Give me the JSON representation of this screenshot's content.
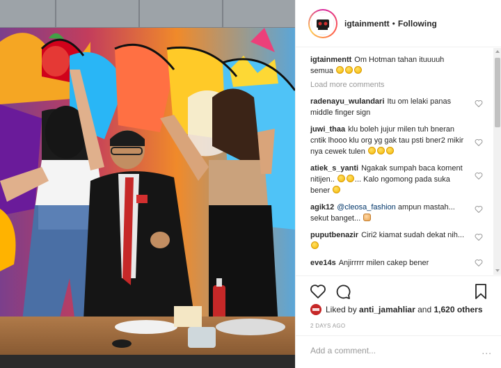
{
  "post": {
    "username": "igtainmentt",
    "separator": "•",
    "follow_state": "Following"
  },
  "caption": {
    "user": "igtainmentt",
    "text": "Om Hotman tahan ituuuuh semua"
  },
  "load_more": "Load more comments",
  "comments": [
    {
      "user": "radenayu_wulandari",
      "text": "Itu om lelaki panas middle finger sign"
    },
    {
      "user": "juwi_thaa",
      "text": "klu boleh jujur milen tuh bneran cntik lhooo klu org yg gak tau psti bner2 mikir nya cewek tulen"
    },
    {
      "user": "atiek_s_yanti",
      "text_a": "Ngakak sumpah baca koment nitijen..",
      "text_b": "... Kalo ngomong pada suka bener"
    },
    {
      "user": "agik12",
      "mention": "@cleosa_fashion",
      "text": "ampun mastah... sekut banget..."
    },
    {
      "user": "puputbenazir",
      "text": "Ciri2 kiamat sudah dekat nih..."
    },
    {
      "user": "eve14s",
      "text": "Anjirrrrr milen cakep bener"
    }
  ],
  "likes": {
    "prefix": "Liked by",
    "user": "anti_jamahliar",
    "conjunction": "and",
    "others": "1,620 others"
  },
  "date": "2 DAYS AGO",
  "add_comment": {
    "placeholder": "Add a comment...",
    "more": "..."
  },
  "icons": {
    "like": "heart-icon",
    "comment": "comment-icon",
    "save": "bookmark-icon",
    "comment_like": "heart-outline-icon"
  },
  "colors": {
    "link": "#003569",
    "muted": "#999999",
    "text": "#262626",
    "border": "#efefef"
  }
}
